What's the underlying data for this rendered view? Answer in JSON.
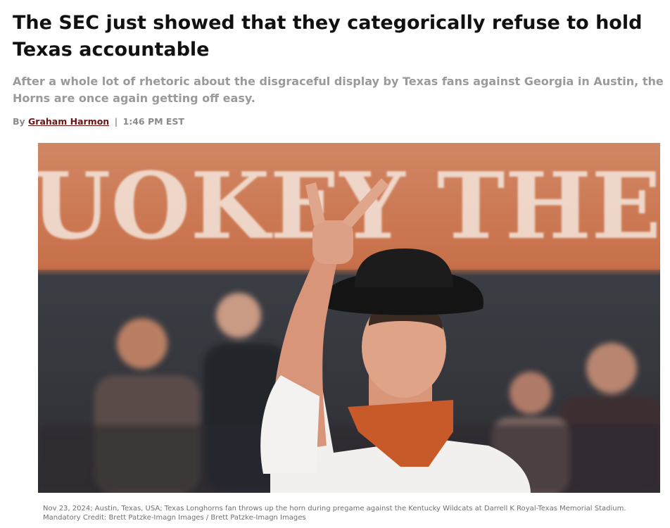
{
  "article": {
    "headline": "The SEC just showed that they categorically refuse to hold Texas accountable",
    "dek": "After a whole lot of rhetoric about the disgraceful display by Texas fans against Georgia in Austin, the Horns are once again getting off easy.",
    "byline_prefix": "By",
    "author": "Graham Harmon",
    "separator": "|",
    "time": "1:46 PM EST"
  },
  "photo": {
    "banner_text": "UOKEY THE C",
    "caption": "Nov 23, 2024; Austin, Texas, USA; Texas Longhorns fan throws up the horn during pregame against the Kentucky Wildcats at Darrell K Royal-Texas Memorial Stadium. Mandatory Credit: Brett Patzke-Imagn Images / Brett Patzke-Imagn Images"
  },
  "colors": {
    "author_link": "#6b1414",
    "banner_orange": "#c8704a",
    "bandana": "#c85a2a"
  }
}
